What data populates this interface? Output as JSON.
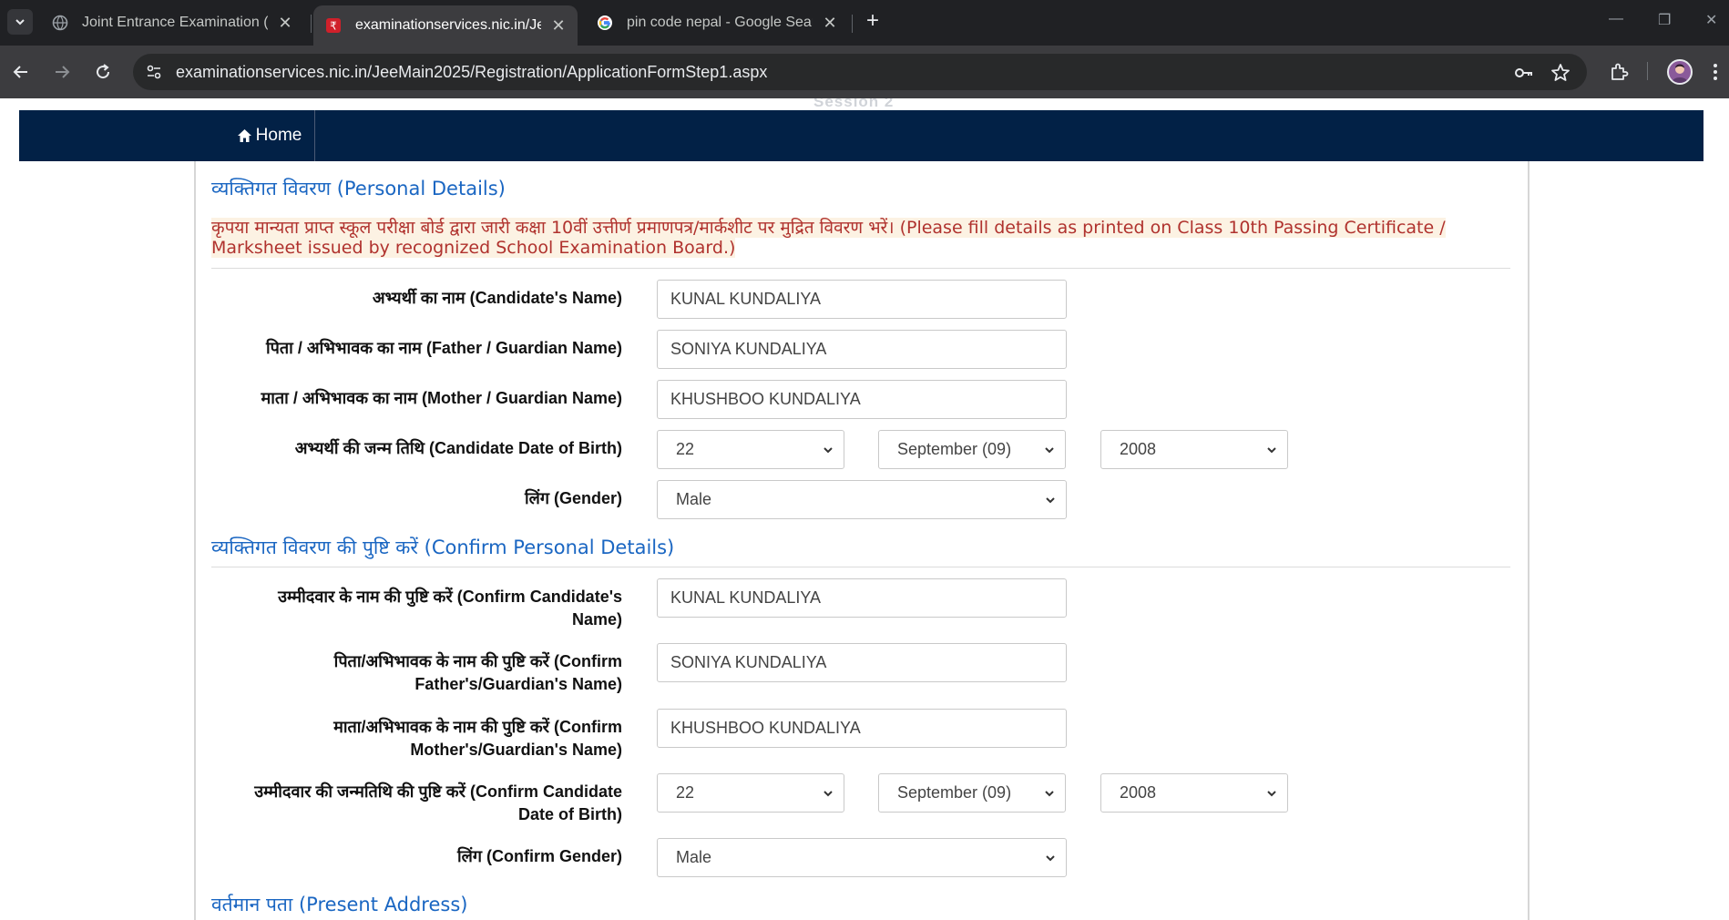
{
  "browser": {
    "tabs": [
      {
        "title": "Joint Entrance Examination (Ma",
        "active": false
      },
      {
        "title": "examinationservices.nic.in/JeeM",
        "active": true
      },
      {
        "title": "pin code nepal - Google Search",
        "active": false
      }
    ],
    "new_tab_label": "+",
    "url": "examinationservices.nic.in/JeeMain2025/Registration/ApplicationFormStep1.aspx",
    "icons": [
      "tab-list-icon",
      "globe-icon",
      "nic-favicon",
      "google-favicon",
      "close-icon",
      "plus-icon",
      "back-icon",
      "forward-icon",
      "reload-icon",
      "site-info-icon",
      "password-key-icon",
      "star-icon",
      "extensions-icon",
      "profile-avatar",
      "more-icon"
    ]
  },
  "navbar": {
    "home_label": "Home",
    "cut_off_text": "Session 2",
    "background": "#022146"
  },
  "personal_details": {
    "title": "व्यक्तिगत विवरण (Personal Details)",
    "notice_hindi": "कृपया मान्यता प्राप्त स्कूल परीक्षा बोर्ड द्वारा जारी कक्षा 10वीं उत्तीर्ण प्रमाणपत्र/मार्कशीट पर मुद्रित विवरण भरें।",
    "notice_english": " (Please fill details as printed on Class 10th Passing Certificate / Marksheet issued by recognized School Examination Board.)",
    "candidate_name_label": "अभ्यर्थी का नाम (Candidate's Name)",
    "candidate_name_value": "KUNAL KUNDALIYA",
    "father_name_label": "पिता / अभिभावक का नाम (Father / Guardian Name)",
    "father_name_value": "SONIYA KUNDALIYA",
    "mother_name_label": "माता / अभिभावक का नाम (Mother / Guardian Name)",
    "mother_name_value": "KHUSHBOO KUNDALIYA",
    "dob_label": "अभ्यर्थी की जन्म तिथि (Candidate Date of Birth)",
    "dob_day": "22",
    "dob_month": "September (09)",
    "dob_year": "2008",
    "gender_label": "लिंग (Gender)",
    "gender_value": "Male"
  },
  "confirm_details": {
    "title": "व्यक्तिगत विवरण की पुष्टि करें (Confirm Personal Details)",
    "candidate_name_label_1": "उम्मीदवार के नाम की पुष्टि करें (Confirm Candidate's",
    "candidate_name_label_2": "Name)",
    "candidate_name_value": "KUNAL KUNDALIYA",
    "father_name_label_1": "पिता/अभिभावक के नाम की पुष्टि करें (Confirm",
    "father_name_label_2": "Father's/Guardian's Name)",
    "father_name_value": "SONIYA KUNDALIYA",
    "mother_name_label_1": "माता/अभिभावक के नाम की पुष्टि करें (Confirm",
    "mother_name_label_2": "Mother's/Guardian's Name)",
    "mother_name_value": "KHUSHBOO KUNDALIYA",
    "dob_label_1": "उम्मीदवार की जन्मतिथि की पुष्टि करें (Confirm Candidate",
    "dob_label_2": "Date of Birth)",
    "dob_day": "22",
    "dob_month": "September (09)",
    "dob_year": "2008",
    "gender_label": "लिंग (Confirm Gender)",
    "gender_value": "Male"
  },
  "present_address": {
    "title": "वर्तमान पता (Present Address)"
  },
  "colors": {
    "section_title": "#1a66c2",
    "notice_text": "#b0322e",
    "notice_highlight": "#fcf2e3"
  }
}
